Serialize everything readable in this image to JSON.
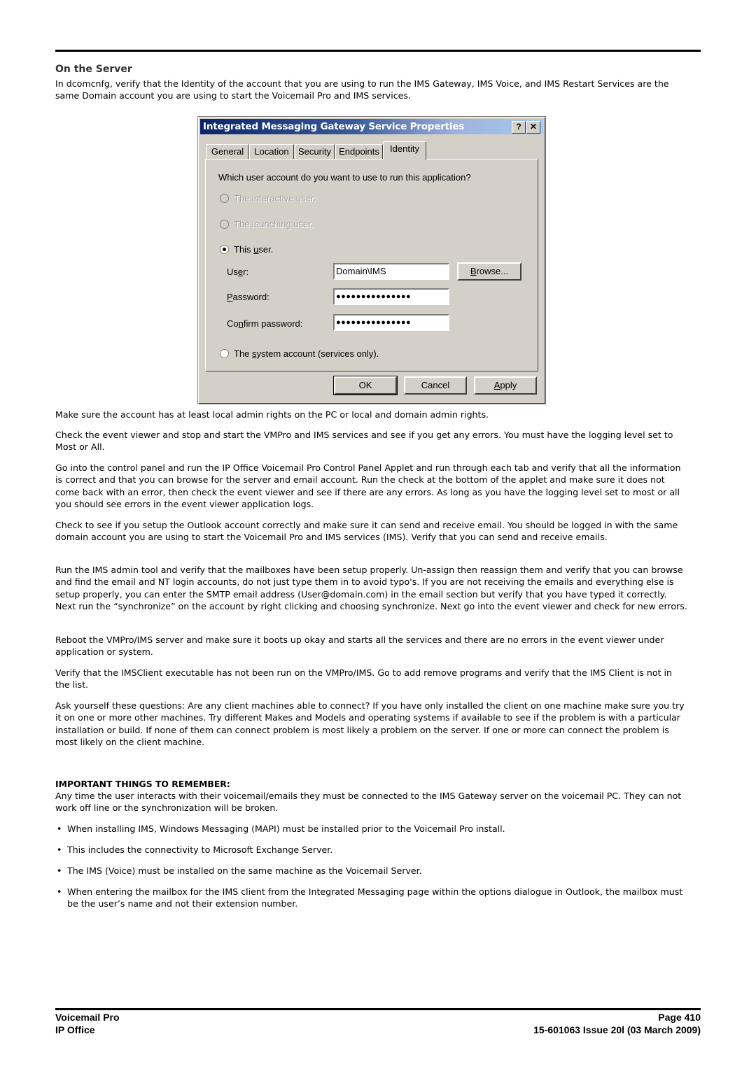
{
  "section_title": "On the Server",
  "intro": "In dcomcnfg, verify that the Identity of the account that you are using to run the IMS Gateway, IMS Voice, and IMS Restart Services are the same Domain account you are using to start the Voicemail Pro and IMS services.",
  "dialog": {
    "title": "Integrated Messaging Gateway Service Properties",
    "help_button": "?",
    "close_button": "✕",
    "tabs": [
      {
        "label": "General",
        "active": false
      },
      {
        "label": "Location",
        "active": false
      },
      {
        "label": "Security",
        "active": false
      },
      {
        "label": "Endpoints",
        "active": false
      },
      {
        "label": "Identity",
        "active": true
      }
    ],
    "question": "Which user account do you want to use to run this application?",
    "options": {
      "interactive": "The interactive user.",
      "launching": "The launching user.",
      "this_user": "This user.",
      "system": "The system account (services only)."
    },
    "selected_option": "this_user",
    "user_label": "User:",
    "user_value": "Domain\\IMS",
    "password_label": "Password:",
    "password_value": "●●●●●●●●●●●●●●●",
    "confirm_label": "Confirm password:",
    "confirm_value": "●●●●●●●●●●●●●●●",
    "browse_button": "Browse...",
    "ok_button": "OK",
    "cancel_button": "Cancel",
    "apply_button": "Apply"
  },
  "paragraphs": [
    "Make sure the account has at least local admin rights on the PC or local and domain admin rights.",
    "Check the event viewer and stop and start the VMPro and IMS services and see if you get any errors. You must have the logging level set to Most or All.",
    "Go into the control panel and run the IP Office Voicemail Pro Control Panel Applet and run through each tab and verify that all the information is correct and that you can browse for the server and email account. Run the check at the bottom of the applet and make sure it does not come back with an error, then check the event viewer and see if there are any errors. As long as you have the logging level set to most or all you should see errors in the event viewer application logs.",
    "Check to see if you setup the Outlook account correctly and make sure it can send and receive email. You should be logged in with the same domain account you are using to start the Voicemail Pro and IMS services (IMS). Verify that you can send and receive emails.",
    "Run the IMS admin tool and verify that the mailboxes have been setup properly. Un-assign then reassign them and verify that you can  browse and find the email and NT login accounts, do not just type them in to avoid typo's. If you are not receiving the emails and everything else is setup properly, you can enter the SMTP email address (User@domain.com) in the email section but verify that you have typed it correctly. Next run the “synchronize” on the account by right clicking and choosing synchronize. Next go into the event viewer and check for new errors.",
    "Reboot the VMPro/IMS server and make sure it boots up okay and starts all the services and there are no errors in the event viewer under application or system.",
    "Verify that the IMSClient executable has not been run on the VMPro/IMS. Go to add remove programs and verify that the IMS Client is not in the list.",
    "Ask yourself these questions: Are any client machines able to connect? If you have only installed the client on one machine make sure you try it on one or more other machines. Try different Makes and Models and operating systems if available to see if the problem is with a particular installation or build. If none of them can connect problem is most likely a problem on the server. If one or more can connect the problem is most likely on the client machine."
  ],
  "important": {
    "heading": "IMPORTANT THINGS TO REMEMBER:",
    "text": "Any time the user interacts with their voicemail/emails they must be connected to the IMS Gateway server on the voicemail PC. They can not work off line or the synchronization will be broken.",
    "bullets": [
      "When installing IMS, Windows Messaging (MAPI) must be installed prior to the Voicemail Pro install.",
      "This includes the connectivity to Microsoft Exchange Server.",
      "The IMS (Voice) must be installed on the same machine as the Voicemail Server.",
      "When entering the mailbox for the IMS client from the Integrated Messaging page within the options dialogue in Outlook, the mailbox must be the user’s name and not their extension number."
    ],
    "bullet_glyph": "•"
  },
  "footer": {
    "left_line1": "Voicemail Pro",
    "left_line2": "IP Office",
    "right_line1": "Page 410",
    "right_line2": "15-601063 Issue 20l (03 March 2009)"
  }
}
